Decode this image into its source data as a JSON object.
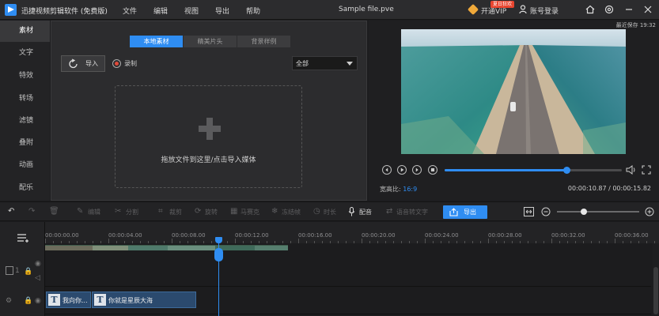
{
  "app": {
    "title": "迅捷视频剪辑软件 (免费版)",
    "menu": [
      "文件",
      "编辑",
      "视图",
      "导出",
      "帮助"
    ],
    "file_name": "Sample file.pve",
    "vip_label": "开通VIP",
    "vip_badge": "夏日狂欢",
    "login_label": "账号登录"
  },
  "sidebar": {
    "items": [
      "素材",
      "文字",
      "特效",
      "转场",
      "滤镜",
      "叠附",
      "动画",
      "配乐"
    ],
    "active_index": 0
  },
  "media": {
    "tabs": [
      "本地素材",
      "精美片头",
      "背景样例"
    ],
    "active_tab": 0,
    "import_label": "导入",
    "record_label": "录制",
    "filter_value": "全部",
    "drop_text": "拖放文件到这里/点击导入媒体"
  },
  "preview": {
    "saved_text": "最近保存 19:32",
    "aspect_label": "宽高比:",
    "aspect_value": "16:9",
    "current_time": "00:00:10.87",
    "total_time": "00:00:15.82",
    "timecode": "00:00:10.87 / 00:00:15.82",
    "progress_fraction": 0.687
  },
  "toolbar": {
    "edit_label": "编辑",
    "split_label": "分割",
    "crop_label": "裁剪",
    "mosaic_label": "马赛克",
    "rotate_label": "旋转",
    "freeze_label": "冻结帧",
    "duration_label": "时长",
    "dub_label": "配音",
    "speech_to_text_label": "语音转文字",
    "export_label": "导出",
    "zoom_fraction": 0.33
  },
  "timeline": {
    "ticks": [
      "00:00:00.00",
      "00:00:04.00",
      "00:00:08.00",
      "00:00:12.00",
      "00:00:16.00",
      "00:00:20.00",
      "00:00:24.00",
      "00:00:28.00",
      "00:00:32.00",
      "00:00:36.00"
    ],
    "track1_index": "1",
    "text_clips": [
      "我向你...",
      "你就是星辰大海"
    ],
    "colors": {
      "accent": "#2f8df2",
      "clip": "#2b4a6e"
    }
  }
}
